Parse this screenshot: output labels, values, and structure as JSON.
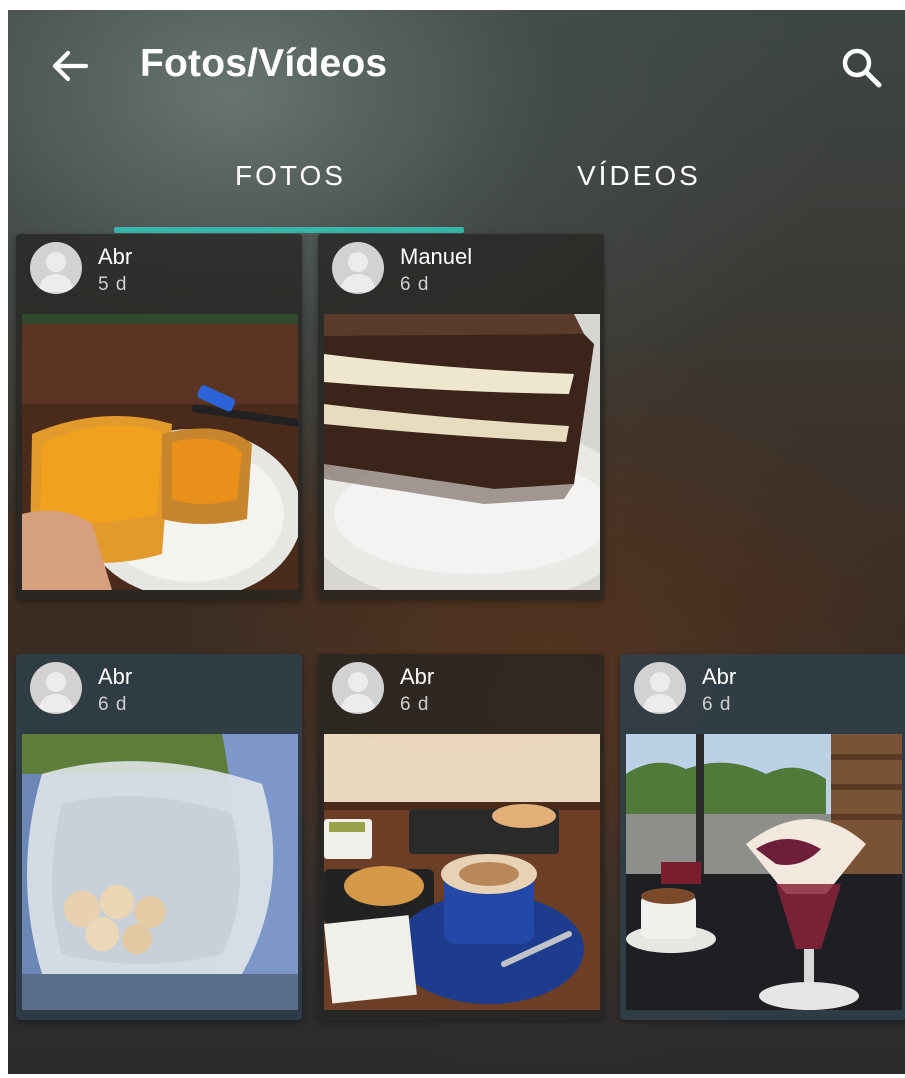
{
  "header": {
    "title": "Fotos/Vídeos"
  },
  "tabs": [
    {
      "label": "FOTOS",
      "selected": true
    },
    {
      "label": "VÍDEOS",
      "selected": false
    }
  ],
  "accent_color": "#38b5a8",
  "photos": [
    {
      "user": "Abr",
      "age": "5 d",
      "subject": "toast with apricot jam on a plate"
    },
    {
      "user": "Manuel",
      "age": "6 d",
      "subject": "slice of tiramisu cake"
    },
    {
      "user": "Abr",
      "age": "6 d",
      "subject": "bag of bread rolls on jeans"
    },
    {
      "user": "Abr",
      "age": "6 d",
      "subject": "cappuccino and toasts on a table"
    },
    {
      "user": "Abr",
      "age": "6 d",
      "subject": "ice cream sundae and coffee on a terrace"
    }
  ],
  "icons": [
    "arrow-left-icon",
    "search-icon",
    "avatar-placeholder-icon"
  ]
}
